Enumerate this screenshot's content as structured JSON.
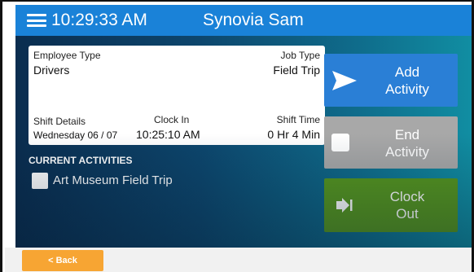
{
  "header": {
    "time": "10:29:33 AM",
    "title": "Synovia Sam",
    "menu_icon": "hamburger-menu-icon"
  },
  "info_card": {
    "employee_type_label": "Employee Type",
    "employee_type_value": "Drivers",
    "job_type_label": "Job Type",
    "job_type_value": "Field Trip",
    "shift_details_label": "Shift Details",
    "shift_details_value": "Wednesday 06 / 07",
    "clock_in_label": "Clock In",
    "clock_in_value": "10:25:10 AM",
    "shift_time_label": "Shift Time",
    "shift_time_value": "0 Hr 4 Min"
  },
  "activities": {
    "heading": "CURRENT ACTIVITIES",
    "items": [
      {
        "label": "Art Museum Field Trip",
        "checked": false
      }
    ]
  },
  "actions": {
    "add_line1": "Add",
    "add_line2": "Activity",
    "end_line1": "End",
    "end_line2": "Activity",
    "clock_line1": "Clock",
    "clock_line2": "Out",
    "add_icon": "play-icon",
    "end_icon": "square-icon",
    "clock_icon": "sign-out-icon"
  },
  "footer": {
    "back_label": "< Back"
  },
  "colors": {
    "topbar": "#1a82d8",
    "add_button": "#2a7fd6",
    "end_button": "#a8a8a8",
    "clock_out_button": "#56961f",
    "back_button": "#f7a533"
  }
}
